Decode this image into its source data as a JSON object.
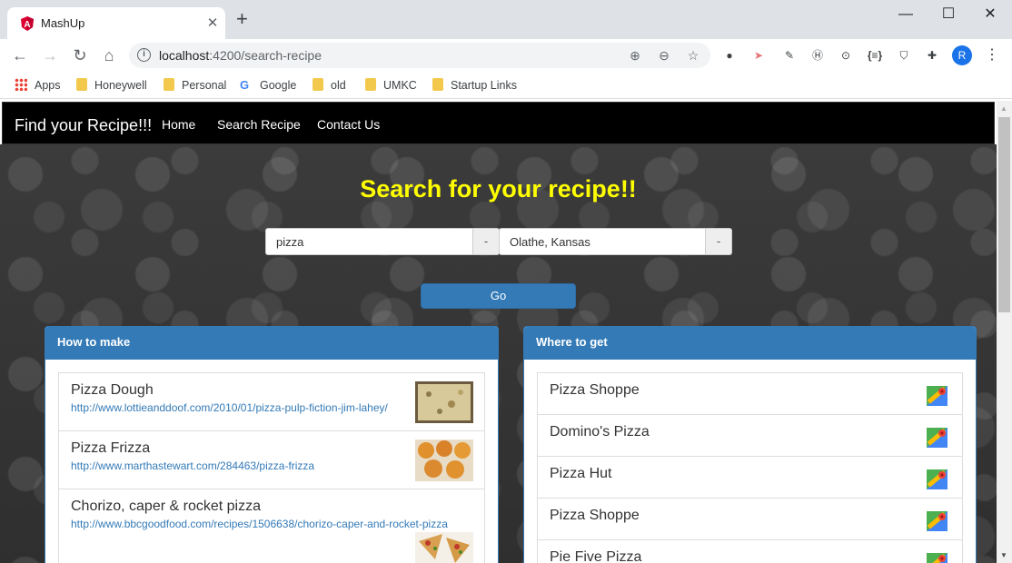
{
  "browser": {
    "tab_title": "MashUp",
    "tab_close": "✕",
    "new_tab": "+",
    "minimize": "—",
    "maximize": "☐",
    "close": "✕",
    "url_host": "localhost",
    "url_path": ":4200/search-recipe",
    "avatar_initial": "R",
    "bookmarks": [
      {
        "label": "Apps",
        "icon": "apps-grid-icon"
      },
      {
        "label": "Honeywell",
        "icon": "folder-icon"
      },
      {
        "label": "Personal",
        "icon": "folder-icon"
      },
      {
        "label": "Google",
        "icon": "google-icon"
      },
      {
        "label": "old",
        "icon": "folder-icon"
      },
      {
        "label": "UMKC",
        "icon": "folder-icon"
      },
      {
        "label": "Startup Links",
        "icon": "folder-icon"
      }
    ]
  },
  "navbar": {
    "brand": "Find your Recipe!!!",
    "links": [
      "Home",
      "Search Recipe",
      "Contact Us"
    ]
  },
  "search": {
    "heading": "Search for your recipe!!",
    "recipe_value": "pizza",
    "recipe_addon": "-",
    "location_value": "Olathe, Kansas",
    "location_addon": "-",
    "go_label": "Go"
  },
  "how_to_make": {
    "title": "How to make",
    "items": [
      {
        "name": "Pizza Dough",
        "link": "http://www.lottieanddoof.com/2010/01/pizza-pulp-fiction-jim-lahey/"
      },
      {
        "name": "Pizza Frizza",
        "link": "http://www.marthastewart.com/284463/pizza-frizza"
      },
      {
        "name": "Chorizo, caper & rocket pizza",
        "link": "http://www.bbcgoodfood.com/recipes/1506638/chorizo-caper-and-rocket-pizza"
      }
    ]
  },
  "where_to_get": {
    "title": "Where to get",
    "items": [
      "Pizza Shoppe",
      "Domino's Pizza",
      "Pizza Hut",
      "Pizza Shoppe",
      "Pie Five Pizza"
    ]
  },
  "colors": {
    "heading": "#ffff00",
    "primary": "#337ab7",
    "navbar": "#000000"
  }
}
